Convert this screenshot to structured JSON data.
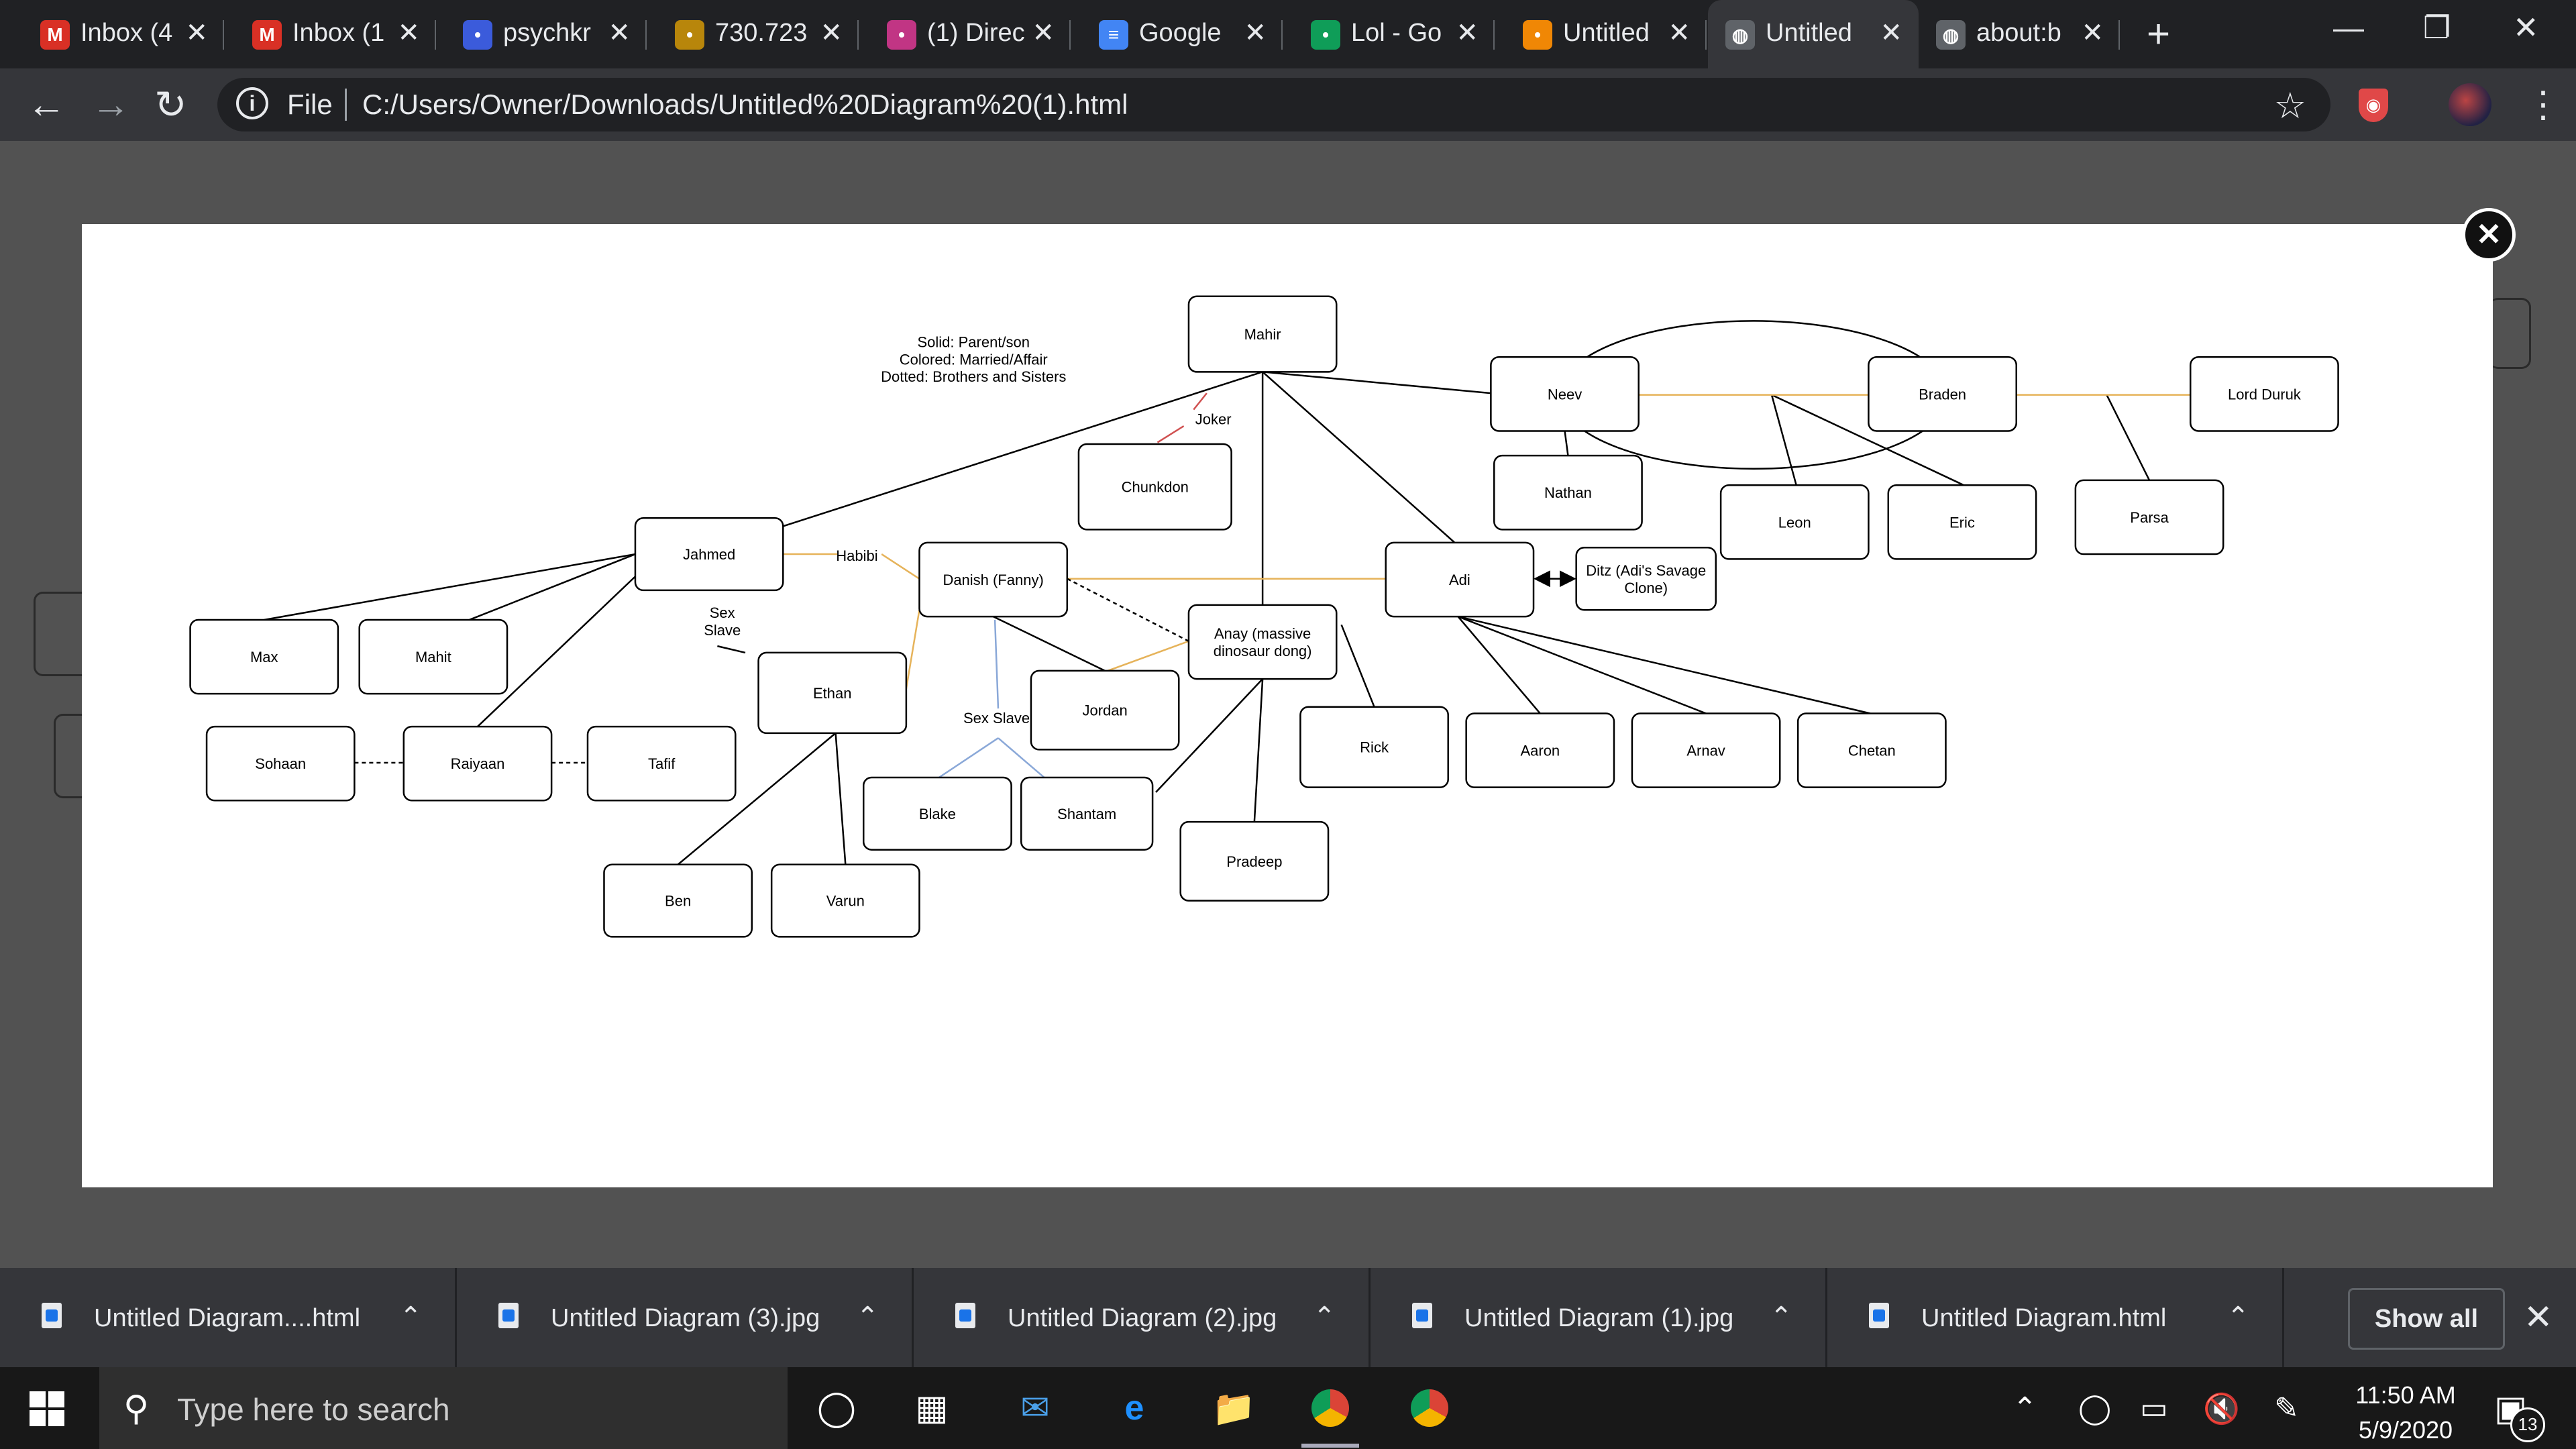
{
  "tabs": [
    {
      "title": "Inbox (4",
      "icon": "gmail-icon",
      "color": "#d93025",
      "active": false
    },
    {
      "title": "Inbox (1",
      "icon": "gmail-icon",
      "color": "#d93025",
      "active": false
    },
    {
      "title": "psychkr",
      "icon": "pen-icon",
      "color": "#3b5bdb",
      "active": false
    },
    {
      "title": "730.723",
      "icon": "coin-icon",
      "color": "#b8860b",
      "active": false
    },
    {
      "title": "(1) Direc",
      "icon": "instagram-icon",
      "color": "#c13584",
      "active": false
    },
    {
      "title": "Google",
      "icon": "docs-icon",
      "color": "#4285f4",
      "active": false
    },
    {
      "title": "Lol - Go",
      "icon": "drive-icon",
      "color": "#0f9d58",
      "active": false
    },
    {
      "title": "Untitled",
      "icon": "drawio-icon",
      "color": "#f08705",
      "active": false
    },
    {
      "title": "Untitled",
      "icon": "globe-icon",
      "color": "#5f6368",
      "active": true
    },
    {
      "title": "about:b",
      "icon": "globe-icon",
      "color": "#5f6368",
      "active": false
    }
  ],
  "address": {
    "scheme_label": "File",
    "url": "C:/Users/Owner/Downloads/Untitled%20Diagram%20(1).html"
  },
  "diagram": {
    "legend": [
      "Solid: Parent/son",
      "Colored: Married/Affair",
      "Dotted: Brothers and Sisters"
    ],
    "nodes": [
      {
        "id": "mahir",
        "label": "Mahir"
      },
      {
        "id": "neev",
        "label": "Neev"
      },
      {
        "id": "braden",
        "label": "Braden"
      },
      {
        "id": "lord",
        "label": "Lord Duruk"
      },
      {
        "id": "nathan",
        "label": "Nathan"
      },
      {
        "id": "leon",
        "label": "Leon"
      },
      {
        "id": "eric",
        "label": "Eric"
      },
      {
        "id": "parsa",
        "label": "Parsa"
      },
      {
        "id": "chunkdon",
        "label": "Chunkdon"
      },
      {
        "id": "jahmed",
        "label": "Jahmed"
      },
      {
        "id": "danish",
        "label": "Danish (Fanny)"
      },
      {
        "id": "adi",
        "label": "Adi"
      },
      {
        "id": "ditz",
        "label": [
          "Ditz (Adi's Savage",
          "Clone)"
        ]
      },
      {
        "id": "anay",
        "label": [
          "Anay (massive",
          "dinosaur dong)"
        ]
      },
      {
        "id": "max",
        "label": "Max"
      },
      {
        "id": "mahit",
        "label": "Mahit"
      },
      {
        "id": "ethan",
        "label": "Ethan"
      },
      {
        "id": "jordan",
        "label": "Jordan"
      },
      {
        "id": "rick",
        "label": "Rick"
      },
      {
        "id": "aaron",
        "label": "Aaron"
      },
      {
        "id": "arnav",
        "label": "Arnav"
      },
      {
        "id": "chetan",
        "label": "Chetan"
      },
      {
        "id": "sohaan",
        "label": "Sohaan"
      },
      {
        "id": "raiyaan",
        "label": "Raiyaan"
      },
      {
        "id": "tafif",
        "label": "Tafif"
      },
      {
        "id": "blake",
        "label": "Blake"
      },
      {
        "id": "shantam",
        "label": "Shantam"
      },
      {
        "id": "pradeep",
        "label": "Pradeep"
      },
      {
        "id": "ben",
        "label": "Ben"
      },
      {
        "id": "varun",
        "label": "Varun"
      }
    ],
    "edge_labels": [
      {
        "id": "joker",
        "text": "Joker"
      },
      {
        "id": "habibi",
        "text": "Habibi"
      },
      {
        "id": "sexslave1",
        "text": [
          "Sex",
          "Slave"
        ]
      },
      {
        "id": "sexslave2",
        "text": "Sex Slave"
      }
    ],
    "relation_colors": {
      "parent": "#000000",
      "married": "#e6b35a",
      "affair_red": "#d05050",
      "blue": "#8aa8d8"
    }
  },
  "downloads": [
    {
      "name": "Untitled Diagram....html",
      "icon": "html-file-icon"
    },
    {
      "name": "Untitled Diagram (3).jpg",
      "icon": "image-file-icon"
    },
    {
      "name": "Untitled Diagram (2).jpg",
      "icon": "image-file-icon"
    },
    {
      "name": "Untitled Diagram (1).jpg",
      "icon": "image-file-icon"
    },
    {
      "name": "Untitled Diagram.html",
      "icon": "html-file-icon"
    }
  ],
  "downloads_show_all": "Show all",
  "taskbar": {
    "search_placeholder": "Type here to search",
    "time": "11:50 AM",
    "date": "5/9/2020",
    "notification_count": "13"
  }
}
